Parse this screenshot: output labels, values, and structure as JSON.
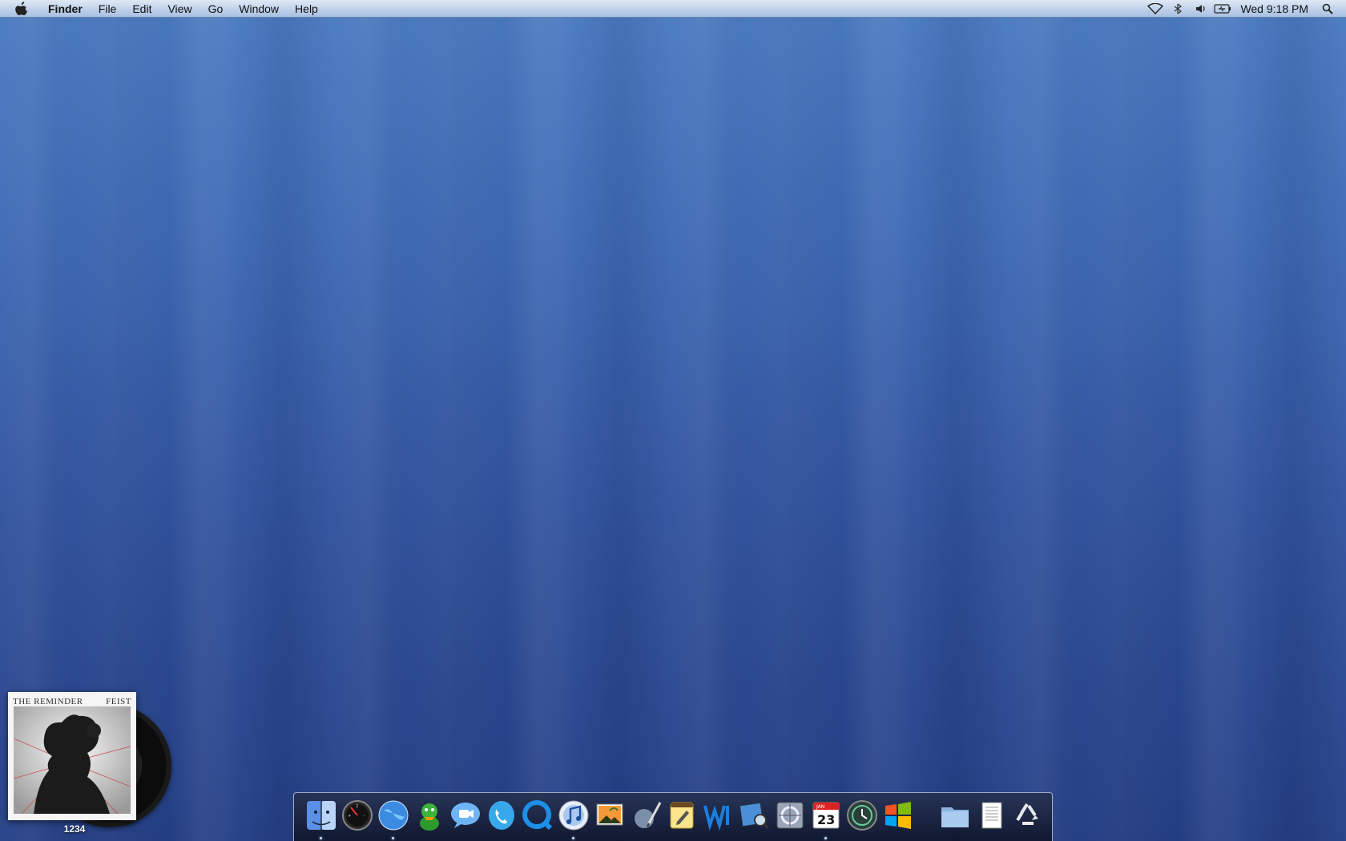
{
  "menubar": {
    "apple_icon": "apple-logo-icon",
    "app_name": "Finder",
    "menus": [
      "File",
      "Edit",
      "View",
      "Go",
      "Window",
      "Help"
    ],
    "status_icons": [
      "wifi-icon",
      "bluetooth-icon",
      "volume-icon",
      "battery-icon"
    ],
    "clock": "Wed 9:18 PM",
    "spotlight_icon": "spotlight-search-icon"
  },
  "album_widget": {
    "cover_title_left": "THE REMINDER",
    "cover_title_right": "FEIST",
    "label": "1234"
  },
  "dock": {
    "apps": [
      {
        "name": "finder-icon",
        "running": true
      },
      {
        "name": "dashboard-icon",
        "running": false
      },
      {
        "name": "network-globe-icon",
        "running": true
      },
      {
        "name": "adium-icon",
        "running": false
      },
      {
        "name": "ichat-icon",
        "running": false
      },
      {
        "name": "skype-icon",
        "running": false
      },
      {
        "name": "quicktime-icon",
        "running": false
      },
      {
        "name": "itunes-icon",
        "running": true
      },
      {
        "name": "iphoto-icon",
        "running": false
      },
      {
        "name": "script-editor-icon",
        "running": false
      },
      {
        "name": "notes-pad-icon",
        "running": false
      },
      {
        "name": "wunderlist-icon",
        "running": false
      },
      {
        "name": "preview-icon",
        "running": false
      },
      {
        "name": "system-preferences-icon",
        "running": false
      },
      {
        "name": "ical-icon",
        "running": true
      },
      {
        "name": "time-machine-icon",
        "running": false
      },
      {
        "name": "windows-icon",
        "running": false
      }
    ],
    "ical_month": "JAN",
    "ical_day": "23",
    "docs": [
      "applications-folder-icon",
      "documents-stack-icon",
      "trash-recycle-icon"
    ]
  }
}
